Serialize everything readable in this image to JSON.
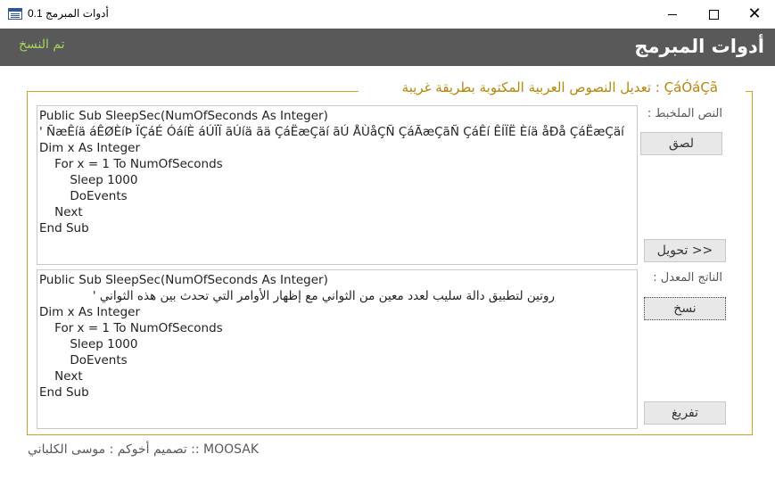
{
  "window": {
    "title": "أدوات المبرمج 0.1",
    "icon": "app-form-icon"
  },
  "header": {
    "title": "أدوات المبرمج",
    "status": "تم النسخ",
    "status_color": "#a6d45a",
    "background": "#595959"
  },
  "group": {
    "legend": "تعديل النصوص العربية المكتوبة بطريقة غريبة : ÇáÓáÇã",
    "accent": "#b8860b"
  },
  "input": {
    "label": "النص الملخبط :",
    "lines": [
      "Public Sub SleepSec(NumOfSeconds As Integer)",
      "' ÑæÊíä áÊØÈíÞ ÏÇáÉ ÓáíÈ áÚÏÏ ãÚíä ãä ÇáËæÇäí ãÚ ÅÙåÇÑ ÇáÃæÇãÑ ÇáÊí ÊÍÏË Èíä åÐå ÇáËæÇäí",
      "Dim x As Integer",
      "    For x = 1 To NumOfSeconds",
      "        Sleep 1000",
      "        DoEvents",
      "    Next",
      "End Sub"
    ]
  },
  "output": {
    "label": "الناتج المعدل :",
    "lines": [
      "Public Sub SleepSec(NumOfSeconds As Integer)",
      "روتين لتطبيق دالة سليب لعدد معين من الثواني مع إظهار الأوامر التي تحدث بين هذه الثواني '",
      "Dim x As Integer",
      "    For x = 1 To NumOfSeconds",
      "        Sleep 1000",
      "        DoEvents",
      "    Next",
      "End Sub"
    ]
  },
  "buttons": {
    "paste": "لصق",
    "convert": "تحويل >>",
    "copy": "نسخ",
    "clear": "تفريغ"
  },
  "footer": {
    "credit": "تصميم أخوكم : موسى الكلباني :: MOOSAK"
  }
}
